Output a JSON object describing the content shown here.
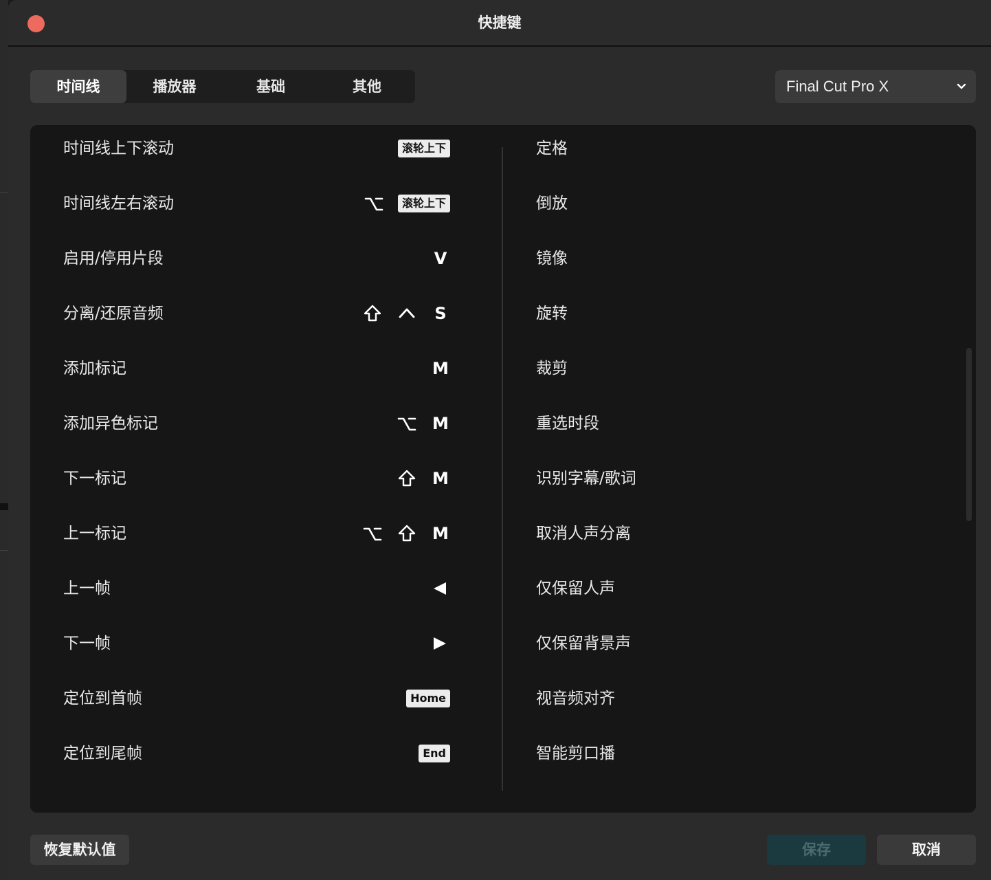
{
  "window": {
    "title": "快捷键"
  },
  "tabs": [
    {
      "label": "时间线",
      "active": true
    },
    {
      "label": "播放器",
      "active": false
    },
    {
      "label": "基础",
      "active": false
    },
    {
      "label": "其他",
      "active": false
    }
  ],
  "preset": {
    "value": "Final Cut Pro X",
    "icon": "chevron-down-icon"
  },
  "left_list": [
    {
      "name": "时间线上下滚动",
      "keys": [
        {
          "kind": "box",
          "text": "滚轮上下"
        }
      ]
    },
    {
      "name": "时间线左右滚动",
      "keys": [
        {
          "kind": "icon",
          "icon": "option-key-icon"
        },
        {
          "kind": "box",
          "text": "滚轮上下"
        }
      ]
    },
    {
      "name": "启用/停用片段",
      "keys": [
        {
          "kind": "text",
          "text": "V"
        }
      ]
    },
    {
      "name": "分离/还原音频",
      "keys": [
        {
          "kind": "icon",
          "icon": "shift-key-icon"
        },
        {
          "kind": "icon",
          "icon": "control-key-icon"
        },
        {
          "kind": "text",
          "text": "S"
        }
      ]
    },
    {
      "name": "添加标记",
      "keys": [
        {
          "kind": "text",
          "text": "M"
        }
      ]
    },
    {
      "name": "添加异色标记",
      "keys": [
        {
          "kind": "icon",
          "icon": "option-key-icon"
        },
        {
          "kind": "text",
          "text": "M"
        }
      ]
    },
    {
      "name": "下一标记",
      "keys": [
        {
          "kind": "icon",
          "icon": "shift-key-icon"
        },
        {
          "kind": "text",
          "text": "M"
        }
      ]
    },
    {
      "name": "上一标记",
      "keys": [
        {
          "kind": "icon",
          "icon": "option-key-icon"
        },
        {
          "kind": "icon",
          "icon": "shift-key-icon"
        },
        {
          "kind": "text",
          "text": "M"
        }
      ]
    },
    {
      "name": "上一帧",
      "keys": [
        {
          "kind": "icon",
          "icon": "left-arrow-key-icon"
        }
      ]
    },
    {
      "name": "下一帧",
      "keys": [
        {
          "kind": "icon",
          "icon": "right-arrow-key-icon"
        }
      ]
    },
    {
      "name": "定位到首帧",
      "keys": [
        {
          "kind": "box",
          "text": "Home"
        }
      ]
    },
    {
      "name": "定位到尾帧",
      "keys": [
        {
          "kind": "box",
          "text": "End"
        }
      ]
    }
  ],
  "right_list": [
    {
      "name": "定格"
    },
    {
      "name": "倒放"
    },
    {
      "name": "镜像"
    },
    {
      "name": "旋转"
    },
    {
      "name": "裁剪"
    },
    {
      "name": "重选时段"
    },
    {
      "name": "识别字幕/歌词"
    },
    {
      "name": "取消人声分离"
    },
    {
      "name": "仅保留人声"
    },
    {
      "name": "仅保留背景声"
    },
    {
      "name": "视音频对齐"
    },
    {
      "name": "智能剪口播"
    }
  ],
  "footer": {
    "restore_label": "恢复默认值",
    "save_label": "保存",
    "cancel_label": "取消"
  },
  "colors": {
    "close": "#ed6a5e",
    "save_bg": "#1a3a3f",
    "panel_bg": "#161616",
    "dialog_bg": "#2b2b2b"
  }
}
